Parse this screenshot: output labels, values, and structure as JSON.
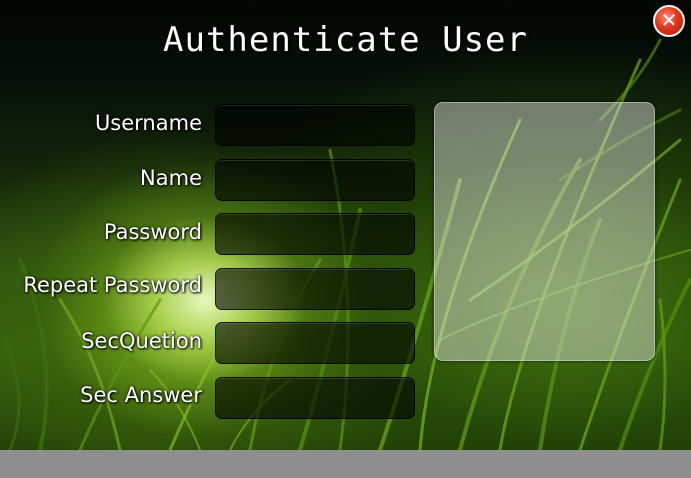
{
  "window": {
    "title": "Authenticate User",
    "close_label": "✕"
  },
  "form": {
    "fields": [
      {
        "label": "Username",
        "value": ""
      },
      {
        "label": "Name",
        "value": ""
      },
      {
        "label": "Password",
        "value": ""
      },
      {
        "label": "Repeat Password",
        "value": ""
      },
      {
        "label": "SecQuetion",
        "value": ""
      },
      {
        "label": "Sec Answer",
        "value": ""
      }
    ]
  },
  "colors": {
    "title_text": "#ffffff",
    "close_button": "#e0361c",
    "input_background": "#000000",
    "status_bar": "#8e8e8e"
  },
  "icons": {
    "close": "close-icon"
  }
}
